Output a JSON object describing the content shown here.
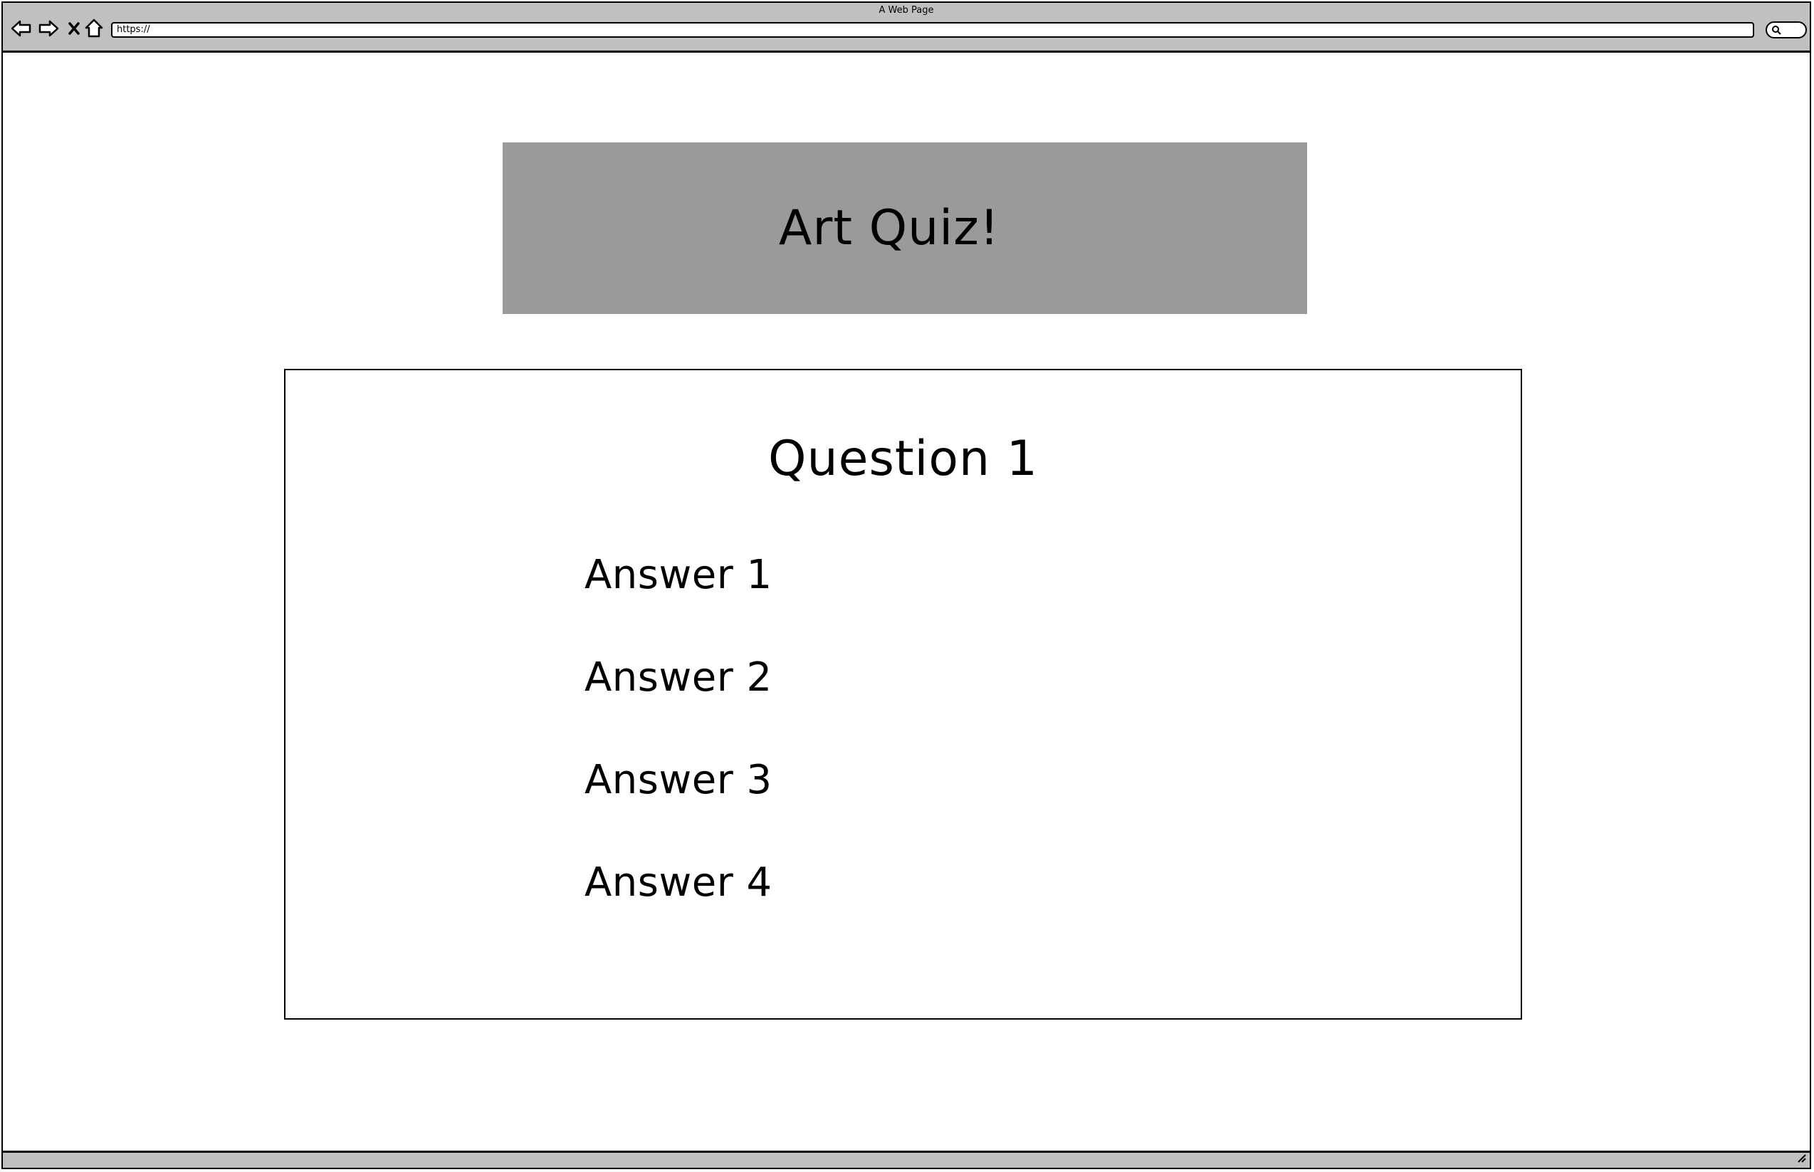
{
  "window": {
    "title": "A Web Page",
    "url": "https://"
  },
  "nav": {
    "back_icon": "back-arrow-icon",
    "forward_icon": "forward-arrow-icon",
    "stop_icon": "close-icon",
    "home_icon": "home-icon",
    "search_icon": "search-icon",
    "resize_icon": "resize-grip-icon"
  },
  "header": {
    "title": "Art Quiz!"
  },
  "quiz": {
    "question": "Question 1",
    "answers": [
      {
        "label": "Answer 1"
      },
      {
        "label": "Answer 2"
      },
      {
        "label": "Answer 3"
      },
      {
        "label": "Answer 4"
      }
    ]
  },
  "colors": {
    "chrome": "#c0c0c0",
    "banner": "#9a9a9a",
    "border": "#000000"
  }
}
